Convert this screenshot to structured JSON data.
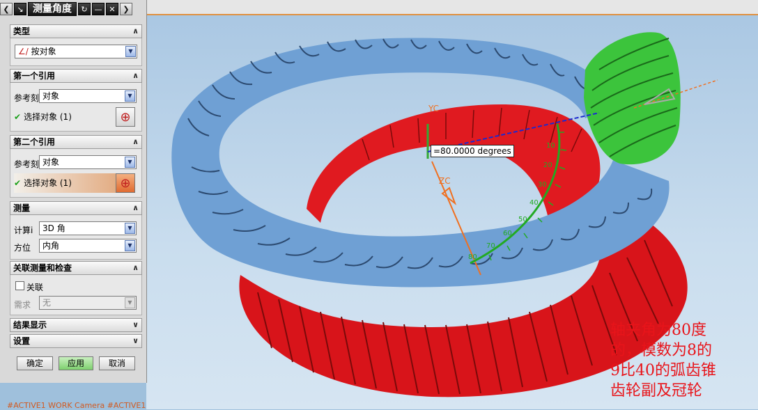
{
  "dialog": {
    "title": "测量角度",
    "sections": {
      "type": {
        "header": "类型",
        "value": "按对象"
      },
      "first_ref": {
        "header": "第一个引用",
        "ref_label": "参考刻",
        "ref_value": "对象",
        "select_label": "选择对象 (1)"
      },
      "second_ref": {
        "header": "第二个引用",
        "ref_label": "参考刻",
        "ref_value": "对象",
        "select_label": "选择对象 (1)"
      },
      "measure": {
        "header": "测量",
        "calc_label": "计算ⅰ",
        "calc_value": "3D 角",
        "orient_label": "方位",
        "orient_value": "内角"
      },
      "assoc": {
        "header": "关联测量和检查",
        "assoc_label": "关联",
        "req_label": "需求",
        "req_value": "无"
      },
      "result": {
        "header": "结果显示"
      },
      "settings": {
        "header": "设置"
      }
    },
    "buttons": {
      "ok": "确定",
      "apply": "应用",
      "cancel": "取消"
    }
  },
  "viewport": {
    "angle_readout": "=80.0000 degrees",
    "axis_yc": "YC",
    "axis_zc": "ZC",
    "protractor_ticks": [
      "10",
      "20",
      "30",
      "40",
      "50",
      "60",
      "70",
      "80"
    ],
    "annotation": [
      "轴夹角为80度",
      "的，模数为8的",
      "9比40的弧齿锥",
      "齿轮副及冠轮"
    ],
    "command_line": "#ACTIVE1 WORK Camera #ACTIVE1"
  },
  "colors": {
    "crown_gear": "#e8141a",
    "bevel_gear": "#6fa0d4",
    "pinion": "#3cc43c",
    "annotation_text": "#e8141a"
  }
}
